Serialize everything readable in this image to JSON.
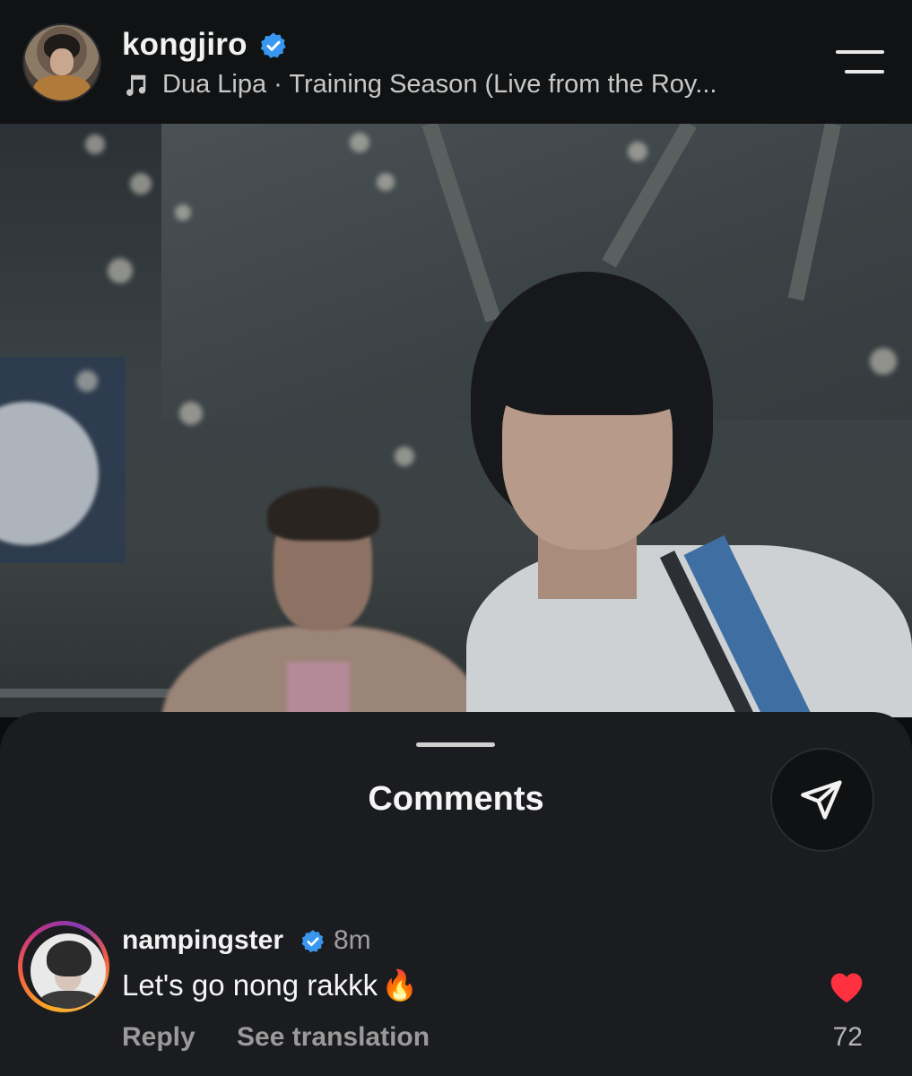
{
  "post_header": {
    "username": "kongjiro",
    "verified": true,
    "music": "Dua Lipa · Training Season (Live from the Roy...",
    "icons": {
      "music": "music-note-icon",
      "menu": "menu-icon",
      "verified": "verified-badge-icon"
    }
  },
  "comments_sheet": {
    "title": "Comments",
    "send_icon": "send-icon",
    "comments": [
      {
        "username": "nampingster",
        "verified": true,
        "time": "8m",
        "text": "Let's go nong rakkk",
        "emoji": "🔥",
        "reply_label": "Reply",
        "translate_label": "See translation",
        "likes": "72",
        "liked": true
      }
    ]
  },
  "colors": {
    "background": "#0b0c0e",
    "sheet": "#1b1c1f",
    "verified_blue": "#3897f0",
    "heart_red": "#ff3040"
  }
}
